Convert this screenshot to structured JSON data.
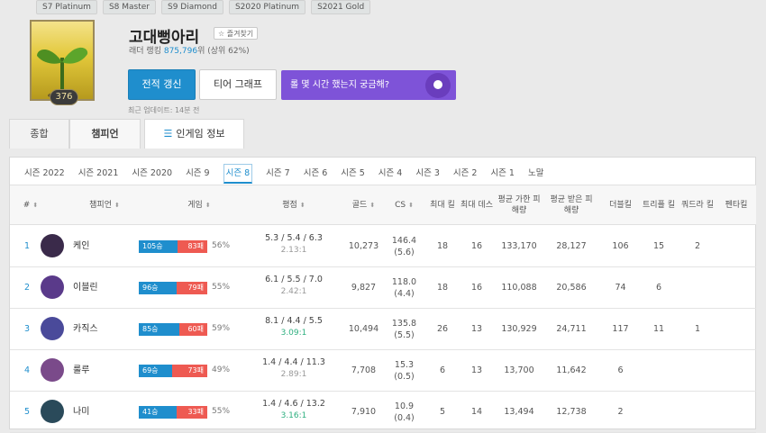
{
  "tier_tags": [
    "S7 Platinum",
    "S8 Master",
    "S9 Diamond",
    "S2020 Platinum",
    "S2021 Gold"
  ],
  "profile": {
    "level": "376",
    "name": "고대뻥아리",
    "favorite_label": "☆ 즐겨찾기",
    "ladder_prefix": "래더 랭킹",
    "ladder_rank": "875,796",
    "ladder_suffix": "위 (상위 62%)",
    "refresh_button": "전적 갱신",
    "tier_graph_button": "티어 그래프",
    "banner_text": "롤 몇 시간 했는지 궁금해?",
    "last_updated": "최근 업데이트: 14분 전"
  },
  "main_tabs": [
    "종합",
    "챔피언",
    "인게임 정보"
  ],
  "season_tabs": [
    "시즌 2022",
    "시즌 2021",
    "시즌 2020",
    "시즌 9",
    "시즌 8",
    "시즌 7",
    "시즌 6",
    "시즌 5",
    "시즌 4",
    "시즌 3",
    "시즌 2",
    "시즌 1",
    "노말"
  ],
  "active_season": "시즌 8",
  "table": {
    "headers": {
      "num": "#",
      "champion": "챔피언",
      "games": "게임",
      "rating": "평점",
      "gold": "골드",
      "cs": "CS",
      "max_kills": "최대 킬",
      "max_deaths": "최대 데스",
      "avg_dealt": "평균 가한 피해량",
      "avg_taken": "평균 받은 피해량",
      "double": "더블킬",
      "triple": "트리플 킬",
      "quadra": "쿼드라 킬",
      "penta": "펜타킬"
    },
    "rows": [
      {
        "rank": "1",
        "champion": "케인",
        "wins": "105승",
        "losses": "83패",
        "win_rate": "56%",
        "win_frac": 0.56,
        "kda": "5.3 / 5.4 / 6.3",
        "ratio": "2.13:1",
        "ratio_good": false,
        "gold": "10,273",
        "cs": "146.4",
        "cs_min": "(5.6)",
        "max_kills": "18",
        "max_deaths": "16",
        "avg_dealt": "133,170",
        "avg_taken": "28,127",
        "double": "106",
        "triple": "15",
        "quadra": "2",
        "penta": "",
        "icon_color": "#3a2a4a"
      },
      {
        "rank": "2",
        "champion": "이블린",
        "wins": "96승",
        "losses": "79패",
        "win_rate": "55%",
        "win_frac": 0.55,
        "kda": "6.1 / 5.5 / 7.0",
        "ratio": "2.42:1",
        "ratio_good": false,
        "gold": "9,827",
        "cs": "118.0",
        "cs_min": "(4.4)",
        "max_kills": "18",
        "max_deaths": "16",
        "avg_dealt": "110,088",
        "avg_taken": "20,586",
        "double": "74",
        "triple": "6",
        "quadra": "",
        "penta": "",
        "icon_color": "#5a3a8a"
      },
      {
        "rank": "3",
        "champion": "카직스",
        "wins": "85승",
        "losses": "60패",
        "win_rate": "59%",
        "win_frac": 0.59,
        "kda": "8.1 / 4.4 / 5.5",
        "ratio": "3.09:1",
        "ratio_good": true,
        "gold": "10,494",
        "cs": "135.8",
        "cs_min": "(5.5)",
        "max_kills": "26",
        "max_deaths": "13",
        "avg_dealt": "130,929",
        "avg_taken": "24,711",
        "double": "117",
        "triple": "11",
        "quadra": "1",
        "penta": "",
        "icon_color": "#4a4a9a"
      },
      {
        "rank": "4",
        "champion": "룰루",
        "wins": "69승",
        "losses": "73패",
        "win_rate": "49%",
        "win_frac": 0.49,
        "kda": "1.4 / 4.4 / 11.3",
        "ratio": "2.89:1",
        "ratio_good": false,
        "gold": "7,708",
        "cs": "15.3",
        "cs_min": "(0.5)",
        "max_kills": "6",
        "max_deaths": "13",
        "avg_dealt": "13,700",
        "avg_taken": "11,642",
        "double": "6",
        "triple": "",
        "quadra": "",
        "penta": "",
        "icon_color": "#7a4a8a"
      },
      {
        "rank": "5",
        "champion": "나미",
        "wins": "41승",
        "losses": "33패",
        "win_rate": "55%",
        "win_frac": 0.55,
        "kda": "1.4 / 4.6 / 13.2",
        "ratio": "3.16:1",
        "ratio_good": true,
        "gold": "7,910",
        "cs": "10.9",
        "cs_min": "(0.4)",
        "max_kills": "5",
        "max_deaths": "14",
        "avg_dealt": "13,494",
        "avg_taken": "12,738",
        "double": "2",
        "triple": "",
        "quadra": "",
        "penta": "",
        "icon_color": "#2a4a5a"
      }
    ]
  }
}
